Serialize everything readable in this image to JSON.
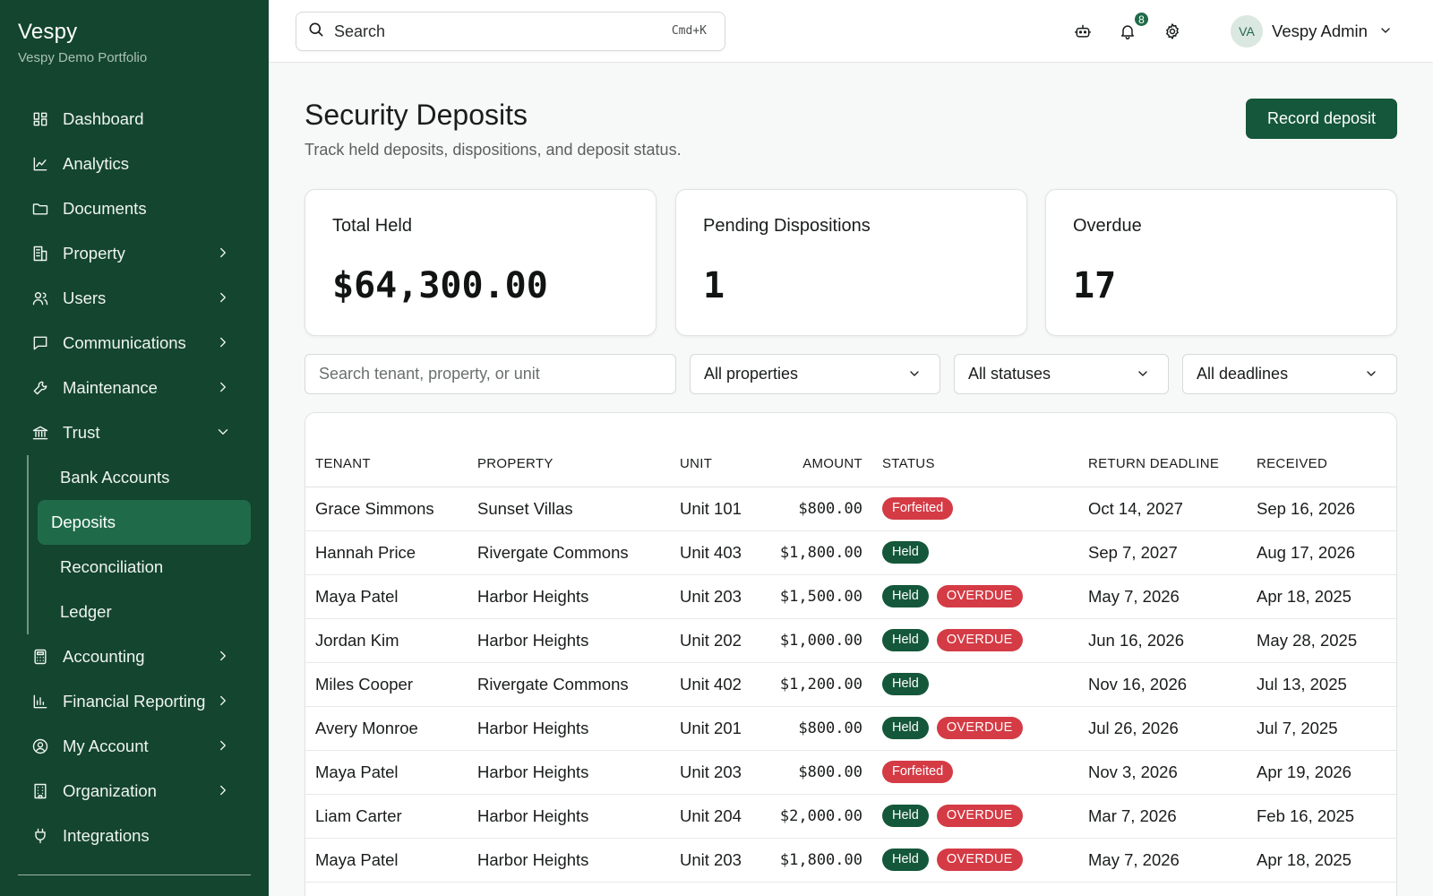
{
  "brand": {
    "name": "Vespy",
    "subtitle": "Vespy Demo Portfolio"
  },
  "sidebar": {
    "items": [
      {
        "label": "Dashboard",
        "icon": "dashboard-icon",
        "chevron": false
      },
      {
        "label": "Analytics",
        "icon": "chart-line-icon",
        "chevron": false
      },
      {
        "label": "Documents",
        "icon": "folder-icon",
        "chevron": false
      },
      {
        "label": "Property",
        "icon": "building-icon",
        "chevron": true
      },
      {
        "label": "Users",
        "icon": "users-icon",
        "chevron": true
      },
      {
        "label": "Communications",
        "icon": "message-icon",
        "chevron": true
      },
      {
        "label": "Maintenance",
        "icon": "wrench-icon",
        "chevron": true
      },
      {
        "label": "Trust",
        "icon": "bank-icon",
        "chevron": "open"
      }
    ],
    "trust_sub": [
      "Bank Accounts",
      "Deposits",
      "Reconciliation",
      "Ledger"
    ],
    "active_sub": "Deposits",
    "items_after": [
      {
        "label": "Accounting",
        "icon": "calculator-icon",
        "chevron": true
      },
      {
        "label": "Financial Reporting",
        "icon": "bar-chart-icon",
        "chevron": true
      },
      {
        "label": "My Account",
        "icon": "user-circle-icon",
        "chevron": true
      },
      {
        "label": "Organization",
        "icon": "office-icon",
        "chevron": true
      },
      {
        "label": "Integrations",
        "icon": "plug-icon",
        "chevron": false
      }
    ]
  },
  "topbar": {
    "search_label": "Search",
    "search_shortcut": "Cmd+K",
    "notification_count": "8",
    "user_initials": "VA",
    "user_name": "Vespy Admin"
  },
  "page": {
    "title": "Security Deposits",
    "subtitle": "Track held deposits, dispositions, and deposit status.",
    "primary_action": "Record deposit"
  },
  "stats": [
    {
      "label": "Total Held",
      "value": "$64,300.00"
    },
    {
      "label": "Pending Dispositions",
      "value": "1"
    },
    {
      "label": "Overdue",
      "value": "17"
    }
  ],
  "filters": {
    "search_placeholder": "Search tenant, property, or unit",
    "property": "All properties",
    "status": "All statuses",
    "deadline": "All deadlines"
  },
  "table": {
    "columns": [
      "TENANT",
      "PROPERTY",
      "UNIT",
      "AMOUNT",
      "STATUS",
      "RETURN DEADLINE",
      "RECEIVED"
    ],
    "rows": [
      {
        "tenant": "Grace Simmons",
        "property": "Sunset Villas",
        "unit": "Unit 101",
        "amount": "$800.00",
        "status": "Forfeited",
        "overdue": "",
        "deadline": "Oct 14, 2027",
        "received": "Sep 16, 2026"
      },
      {
        "tenant": "Hannah Price",
        "property": "Rivergate Commons",
        "unit": "Unit 403",
        "amount": "$1,800.00",
        "status": "Held",
        "overdue": "",
        "deadline": "Sep 7, 2027",
        "received": "Aug 17, 2026"
      },
      {
        "tenant": "Maya Patel",
        "property": "Harbor Heights",
        "unit": "Unit 203",
        "amount": "$1,500.00",
        "status": "Held",
        "overdue": "OVERDUE",
        "deadline": "May 7, 2026",
        "received": "Apr 18, 2025"
      },
      {
        "tenant": "Jordan Kim",
        "property": "Harbor Heights",
        "unit": "Unit 202",
        "amount": "$1,000.00",
        "status": "Held",
        "overdue": "OVERDUE",
        "deadline": "Jun 16, 2026",
        "received": "May 28, 2025"
      },
      {
        "tenant": "Miles Cooper",
        "property": "Rivergate Commons",
        "unit": "Unit 402",
        "amount": "$1,200.00",
        "status": "Held",
        "overdue": "",
        "deadline": "Nov 16, 2026",
        "received": "Jul 13, 2025"
      },
      {
        "tenant": "Avery Monroe",
        "property": "Harbor Heights",
        "unit": "Unit 201",
        "amount": "$800.00",
        "status": "Held",
        "overdue": "OVERDUE",
        "deadline": "Jul 26, 2026",
        "received": "Jul 7, 2025"
      },
      {
        "tenant": "Maya Patel",
        "property": "Harbor Heights",
        "unit": "Unit 203",
        "amount": "$800.00",
        "status": "Forfeited",
        "overdue": "",
        "deadline": "Nov 3, 2026",
        "received": "Apr 19, 2026"
      },
      {
        "tenant": "Liam Carter",
        "property": "Harbor Heights",
        "unit": "Unit 204",
        "amount": "$2,000.00",
        "status": "Held",
        "overdue": "OVERDUE",
        "deadline": "Mar 7, 2026",
        "received": "Feb 16, 2025"
      },
      {
        "tenant": "Maya Patel",
        "property": "Harbor Heights",
        "unit": "Unit 203",
        "amount": "$1,800.00",
        "status": "Held",
        "overdue": "OVERDUE",
        "deadline": "May 7, 2026",
        "received": "Apr 18, 2025"
      }
    ]
  },
  "colors": {
    "sidebar_bg": "#14452f",
    "accent": "#14573a",
    "active_nav": "#1f6b49",
    "danger": "#d43b45"
  }
}
